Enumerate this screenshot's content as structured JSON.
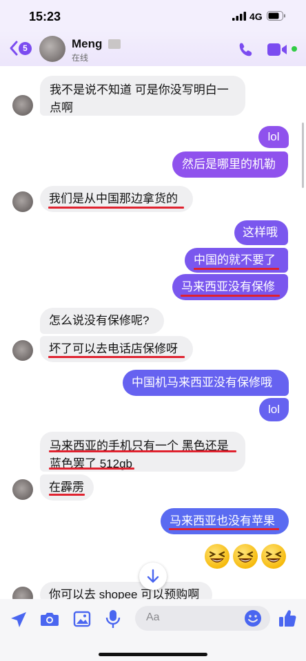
{
  "status_bar": {
    "time": "15:23",
    "network": "4G"
  },
  "header": {
    "back_count": "5",
    "contact_name": "Meng",
    "status": "在线"
  },
  "messages": [
    {
      "side": "in",
      "text_line1": "我不是说不知道 可是你没写明白一",
      "text_line2": "点啊"
    },
    {
      "side": "out",
      "text": "lol"
    },
    {
      "side": "out",
      "text": "然后是哪里的机勒"
    },
    {
      "side": "in",
      "text": "我们是从中国那边拿货的"
    },
    {
      "side": "out",
      "text": "这样哦"
    },
    {
      "side": "out",
      "text": "中国的就不要了"
    },
    {
      "side": "out",
      "text": "马来西亚没有保修"
    },
    {
      "side": "in",
      "text": "怎么说没有保修呢?"
    },
    {
      "side": "in",
      "text": "坏了可以去电话店保修呀"
    },
    {
      "side": "out",
      "text": "中国机马来西亚没有保修哦"
    },
    {
      "side": "out",
      "text": "lol"
    },
    {
      "side": "in",
      "text_line1": "马来西亚的手机只有一个 黑色还是",
      "text_line2": "蓝色罢了 512gb"
    },
    {
      "side": "in",
      "text": "在霹雳"
    },
    {
      "side": "out",
      "text": "马来西亚也没有苹果"
    },
    {
      "side": "out",
      "emoji": "grinning-squinting-face x3"
    },
    {
      "side": "in",
      "text": "你可以去 shopee 可以预购啊"
    }
  ],
  "composer": {
    "placeholder": "Aa"
  },
  "colors": {
    "accent": "#7b4cf0",
    "incoming_bubble": "#efeff1",
    "underline": "#e0212e"
  }
}
